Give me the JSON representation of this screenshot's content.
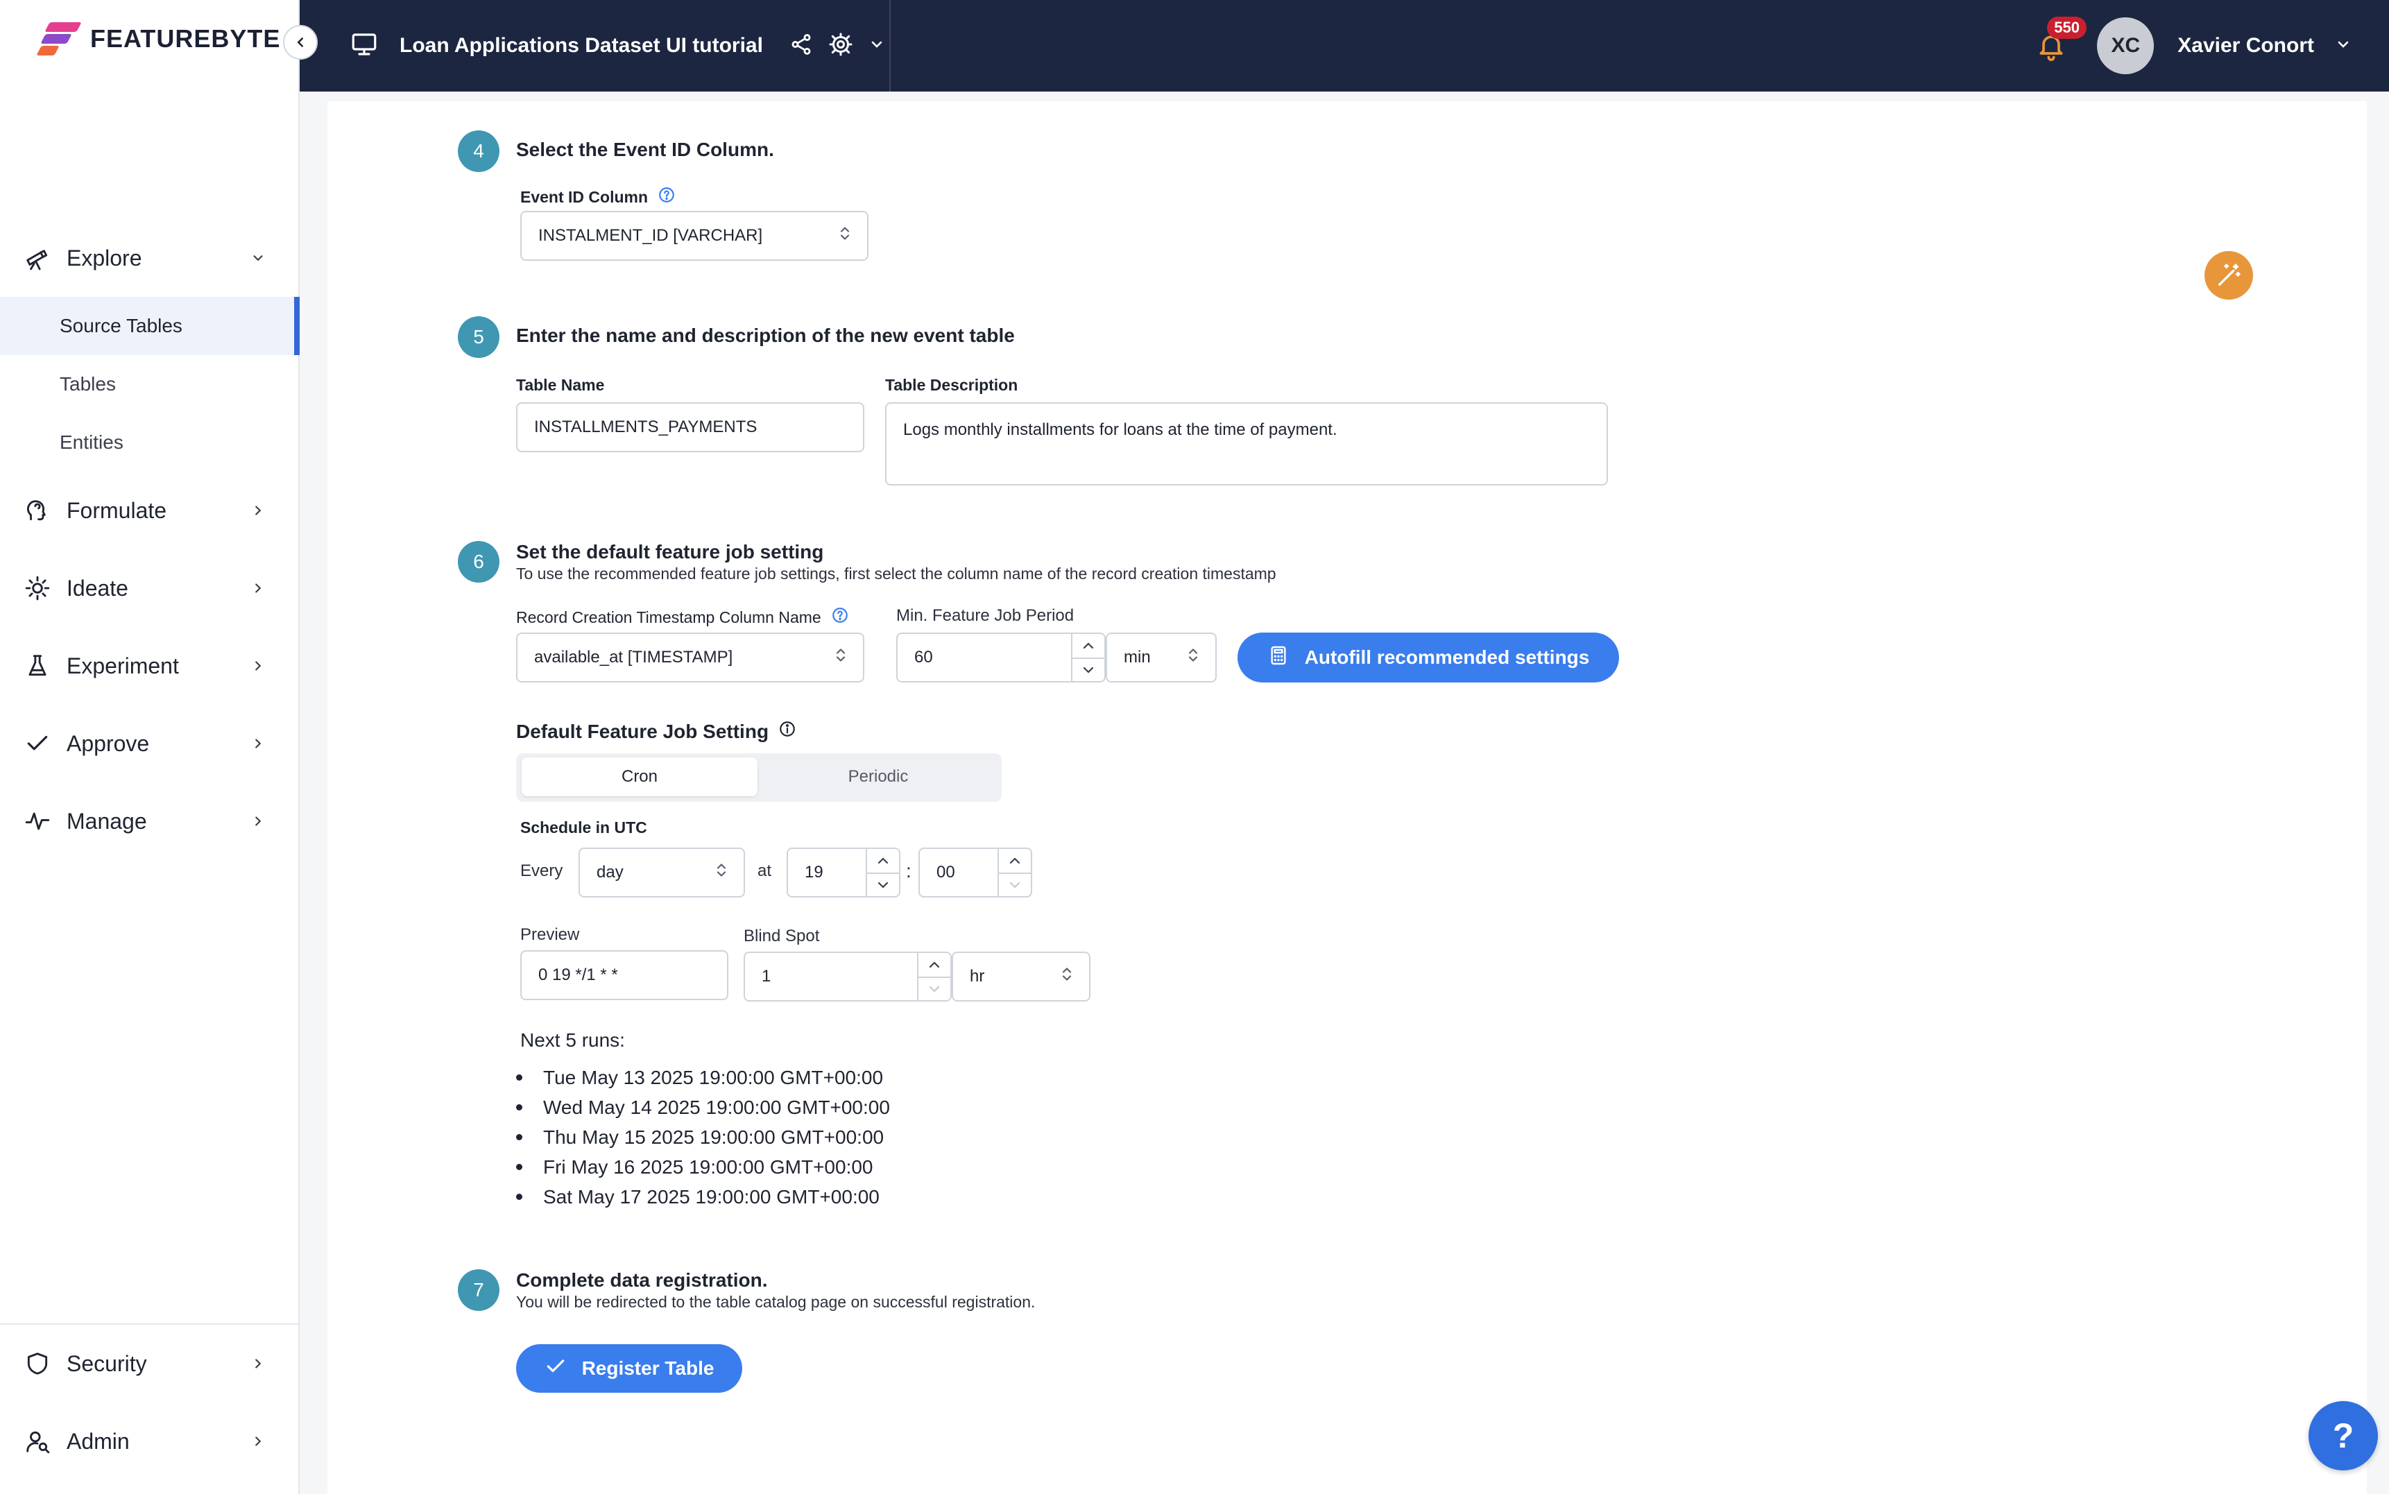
{
  "app": {
    "logo_text": "FEATUREBYTE",
    "catalog_title": "Loan Applications Dataset UI tutorial"
  },
  "user": {
    "initials": "XC",
    "name": "Xavier Conort",
    "notifications": "550"
  },
  "sidebar": {
    "explore": "Explore",
    "source_tables": "Source Tables",
    "tables": "Tables",
    "entities": "Entities",
    "formulate": "Formulate",
    "ideate": "Ideate",
    "experiment": "Experiment",
    "approve": "Approve",
    "manage": "Manage",
    "security": "Security",
    "admin": "Admin"
  },
  "step4": {
    "num": "4",
    "title": "Select the Event ID Column.",
    "event_id_label": "Event ID Column",
    "event_id_value": "INSTALMENT_ID [VARCHAR]"
  },
  "step5": {
    "num": "5",
    "title": "Enter the name and description of the new event table",
    "table_name_label": "Table Name",
    "table_name_value": "INSTALLMENTS_PAYMENTS",
    "table_desc_label": "Table Description",
    "table_desc_value": "Logs monthly installments for loans at the time of payment."
  },
  "step6": {
    "num": "6",
    "title": "Set the default feature job setting",
    "subtitle": "To use the recommended feature job settings, first select the column name of the record creation timestamp",
    "record_ts_label": "Record Creation Timestamp Column Name",
    "record_ts_value": "available_at [TIMESTAMP]",
    "min_period_label": "Min. Feature Job Period",
    "min_period_value": "60",
    "min_period_unit": "min",
    "autofill_label": "Autofill recommended settings",
    "default_setting_label": "Default Feature Job Setting",
    "tab_cron": "Cron",
    "tab_periodic": "Periodic",
    "schedule_label": "Schedule in UTC",
    "every_label": "Every",
    "every_value": "day",
    "at_label": "at",
    "hour_value": "19",
    "colon": ":",
    "minute_value": "00",
    "preview_label": "Preview",
    "preview_value": "0 19 */1 * *",
    "blind_spot_label": "Blind Spot",
    "blind_spot_value": "1",
    "blind_spot_unit": "hr",
    "next_runs_label": "Next 5 runs:",
    "next_runs": [
      "Tue May 13 2025 19:00:00 GMT+00:00",
      "Wed May 14 2025 19:00:00 GMT+00:00",
      "Thu May 15 2025 19:00:00 GMT+00:00",
      "Fri May 16 2025 19:00:00 GMT+00:00",
      "Sat May 17 2025 19:00:00 GMT+00:00"
    ]
  },
  "step7": {
    "num": "7",
    "title": "Complete data registration.",
    "subtitle": "You will be redirected to the table catalog page on successful registration.",
    "register_label": "Register Table"
  },
  "help": {
    "label": "?"
  },
  "colors": {
    "nav_bg": "#1d2640",
    "accent": "#3a7ded",
    "step_badge": "#3f97b2",
    "magic": "#e8963a",
    "notification": "#c8202f"
  }
}
